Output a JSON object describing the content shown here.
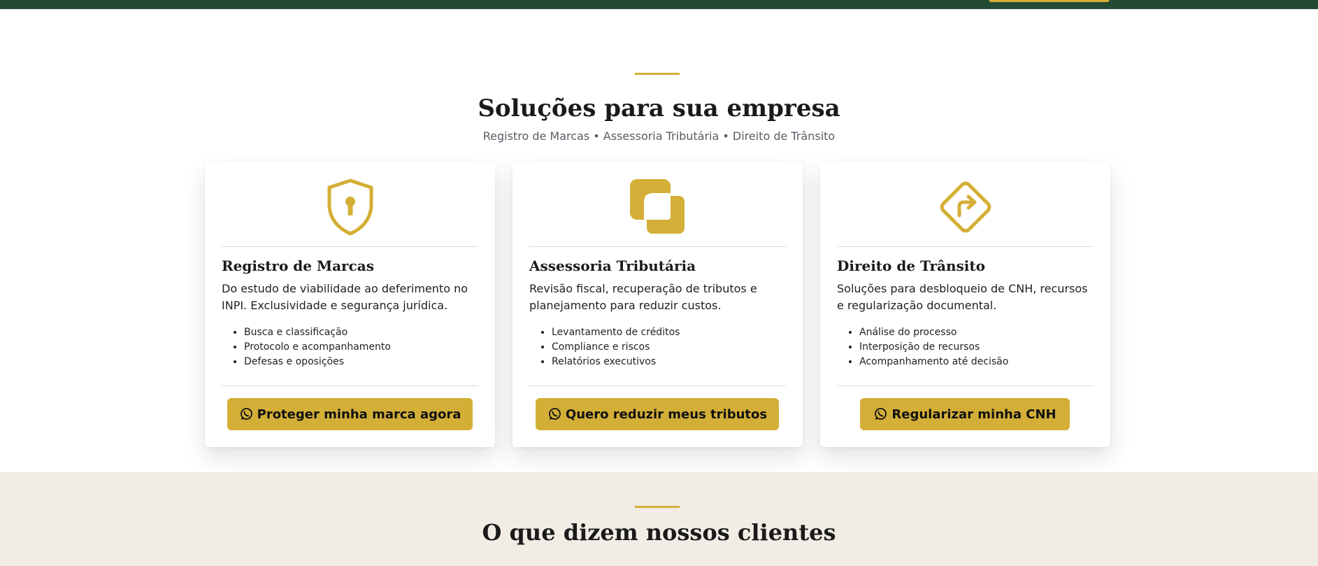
{
  "services": {
    "title": "Soluções para sua empresa",
    "subtitle": "Registro de Marcas • Assessoria Tributária • Direito de Trânsito",
    "cards": [
      {
        "icon": "shield-keyhole-icon",
        "title": "Registro de Marcas",
        "description": "Do estudo de viabilidade ao deferimento no INPI. Exclusividade e segurança jurídica.",
        "items": [
          "Busca e classificação",
          "Protocolo e acompanhamento",
          "Defesas e oposições"
        ],
        "button_label": "Proteger minha marca agora",
        "button_icon": "whatsapp-icon"
      },
      {
        "icon": "overlapping-squares-icon",
        "title": "Assessoria Tributária",
        "description": "Revisão fiscal, recuperação de tributos e planejamento para reduzir custos.",
        "items": [
          "Levantamento de créditos",
          "Compliance e riscos",
          "Relatórios executivos"
        ],
        "button_label": "Quero reduzir meus tributos",
        "button_icon": "whatsapp-icon"
      },
      {
        "icon": "turn-right-sign-icon",
        "title": "Direito de Trânsito",
        "description": "Soluções para desbloqueio de CNH, recursos e regularização documental.",
        "items": [
          "Análise do processo",
          "Interposição de recursos",
          "Acompanhamento até decisão"
        ],
        "button_label": "Regularizar minha CNH",
        "button_icon": "whatsapp-icon"
      }
    ]
  },
  "testimonials": {
    "title": "O que dizem nossos clientes"
  },
  "colors": {
    "header_green": "#234a34",
    "accent_gold": "#d4af37",
    "testimonials_bg": "#f1ede5"
  }
}
